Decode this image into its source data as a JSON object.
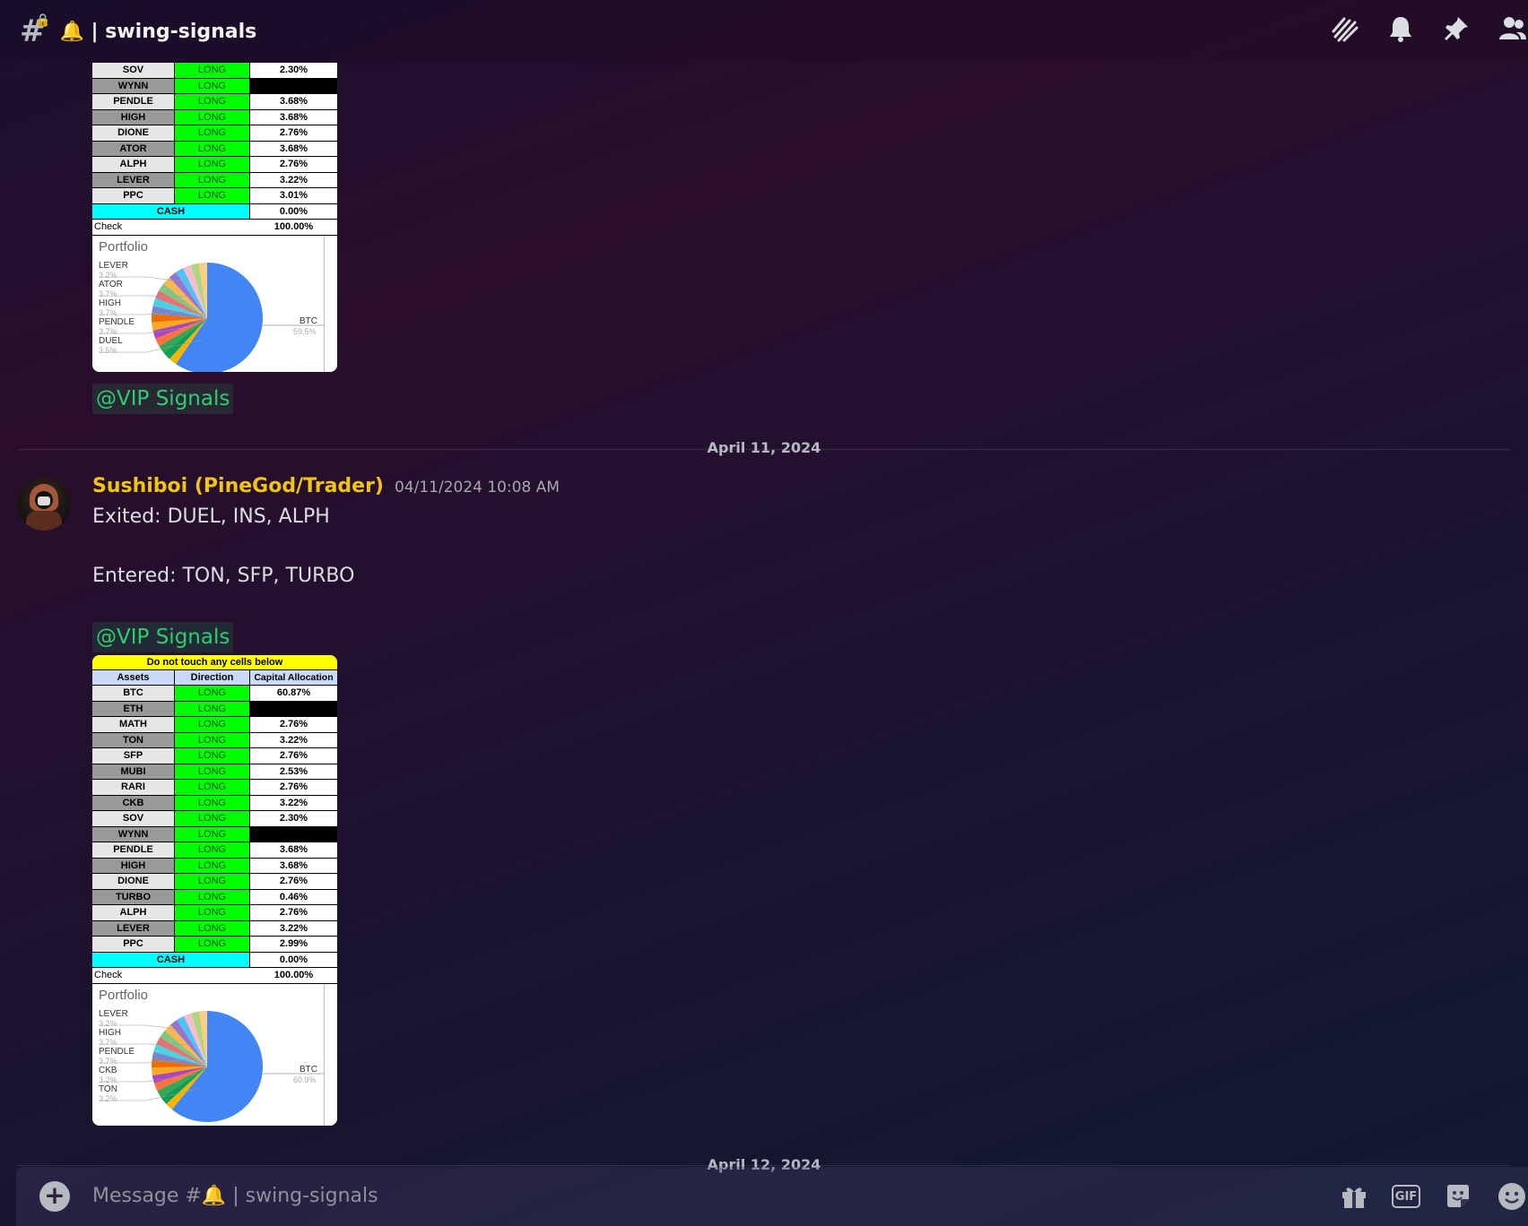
{
  "header": {
    "channel_name": "🔔 | swing-signals"
  },
  "messages": {
    "first": {
      "mention": "@VIP Signals"
    },
    "date_1": "April 11, 2024",
    "second": {
      "author": "Sushiboi (PineGod/Trader)",
      "timestamp": "04/11/2024 10:08 AM",
      "line1": "Exited: DUEL, INS, ALPH",
      "line2": "Entered: TON, SFP, TURBO",
      "mention": "@VIP Signals"
    },
    "date_2": "April 12, 2024"
  },
  "sheet1": {
    "rows": [
      {
        "asset": "SOV",
        "dir": "LONG",
        "alloc": "2.30%",
        "shade": "light"
      },
      {
        "asset": "WYNN",
        "dir": "LONG",
        "alloc": "",
        "shade": "dark"
      },
      {
        "asset": "PENDLE",
        "dir": "LONG",
        "alloc": "3.68%",
        "shade": "light"
      },
      {
        "asset": "HIGH",
        "dir": "LONG",
        "alloc": "3.68%",
        "shade": "dark"
      },
      {
        "asset": "DIONE",
        "dir": "LONG",
        "alloc": "2.76%",
        "shade": "light"
      },
      {
        "asset": "ATOR",
        "dir": "LONG",
        "alloc": "3.68%",
        "shade": "dark"
      },
      {
        "asset": "ALPH",
        "dir": "LONG",
        "alloc": "2.76%",
        "shade": "light"
      },
      {
        "asset": "LEVER",
        "dir": "LONG",
        "alloc": "3.22%",
        "shade": "dark"
      },
      {
        "asset": "PPC",
        "dir": "LONG",
        "alloc": "3.01%",
        "shade": "light"
      }
    ],
    "cash_label": "CASH",
    "cash_value": "0.00%",
    "check_label": "Check",
    "check_value": "100.00%",
    "pie": {
      "title": "Portfolio",
      "labels": [
        {
          "name": "LEVER",
          "pct": "3.2%"
        },
        {
          "name": "ATOR",
          "pct": "3.7%"
        },
        {
          "name": "HIGH",
          "pct": "3.7%"
        },
        {
          "name": "PENDLE",
          "pct": "3.7%"
        },
        {
          "name": "DUEL",
          "pct": "3.5%"
        }
      ],
      "main_name": "BTC",
      "main_pct": "59.5%"
    }
  },
  "sheet2": {
    "banner": "Do not touch any cells below",
    "headers": [
      "Assets",
      "Direction",
      "Capital Allocation"
    ],
    "rows": [
      {
        "asset": "BTC",
        "dir": "LONG",
        "alloc": "60.87%",
        "shade": "light"
      },
      {
        "asset": "ETH",
        "dir": "LONG",
        "alloc": "",
        "shade": "dark"
      },
      {
        "asset": "MATH",
        "dir": "LONG",
        "alloc": "2.76%",
        "shade": "light"
      },
      {
        "asset": "TON",
        "dir": "LONG",
        "alloc": "3.22%",
        "shade": "dark"
      },
      {
        "asset": "SFP",
        "dir": "LONG",
        "alloc": "2.76%",
        "shade": "light"
      },
      {
        "asset": "MUBI",
        "dir": "LONG",
        "alloc": "2.53%",
        "shade": "dark"
      },
      {
        "asset": "RARI",
        "dir": "LONG",
        "alloc": "2.76%",
        "shade": "light"
      },
      {
        "asset": "CKB",
        "dir": "LONG",
        "alloc": "3.22%",
        "shade": "dark"
      },
      {
        "asset": "SOV",
        "dir": "LONG",
        "alloc": "2.30%",
        "shade": "light"
      },
      {
        "asset": "WYNN",
        "dir": "LONG",
        "alloc": "",
        "shade": "dark"
      },
      {
        "asset": "PENDLE",
        "dir": "LONG",
        "alloc": "3.68%",
        "shade": "light"
      },
      {
        "asset": "HIGH",
        "dir": "LONG",
        "alloc": "3.68%",
        "shade": "dark"
      },
      {
        "asset": "DIONE",
        "dir": "LONG",
        "alloc": "2.76%",
        "shade": "light"
      },
      {
        "asset": "TURBO",
        "dir": "LONG",
        "alloc": "0.46%",
        "shade": "dark"
      },
      {
        "asset": "ALPH",
        "dir": "LONG",
        "alloc": "2.76%",
        "shade": "light"
      },
      {
        "asset": "LEVER",
        "dir": "LONG",
        "alloc": "3.22%",
        "shade": "dark"
      },
      {
        "asset": "PPC",
        "dir": "LONG",
        "alloc": "2.99%",
        "shade": "light"
      }
    ],
    "cash_label": "CASH",
    "cash_value": "0.00%",
    "check_label": "Check",
    "check_value": "100.00%",
    "pie": {
      "title": "Portfolio",
      "labels": [
        {
          "name": "LEVER",
          "pct": "3.2%"
        },
        {
          "name": "HIGH",
          "pct": "3.7%"
        },
        {
          "name": "PENDLE",
          "pct": "3.7%"
        },
        {
          "name": "CKB",
          "pct": "3.2%"
        },
        {
          "name": "TON",
          "pct": "3.2%"
        }
      ],
      "main_name": "BTC",
      "main_pct": "60.9%"
    }
  },
  "composer": {
    "placeholder": "Message #🔔 | swing-signals",
    "gif_label": "GIF"
  },
  "icons": {
    "header": [
      "threads-icon",
      "bell-icon",
      "pin-icon",
      "members-icon"
    ],
    "composer": [
      "add-attachment-icon",
      "gift-icon",
      "gif-icon",
      "sticker-icon",
      "emoji-icon"
    ]
  },
  "colors": {
    "author": "#f1c40f",
    "mention": "#2ecc71",
    "long_cell": "#00ff00",
    "cash_cell": "#00ffff",
    "banner": "#ffff00",
    "btc_slice": "#4285f4"
  }
}
